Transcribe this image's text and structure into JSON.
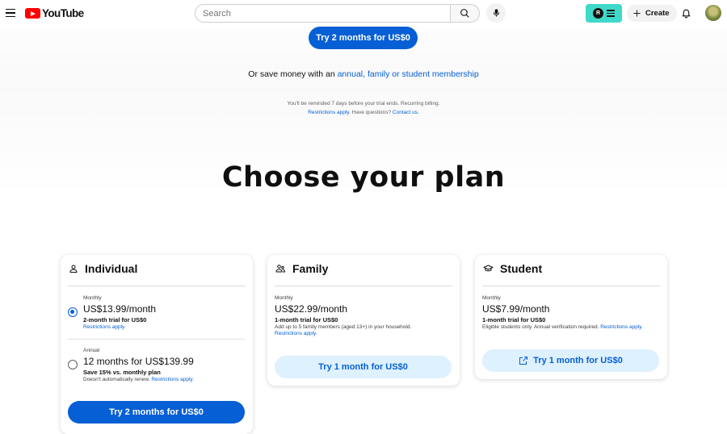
{
  "topbar": {
    "logo_text": "YouTube",
    "search_placeholder": "Search",
    "create_label": "Create",
    "extension_badge": "R"
  },
  "hero": {
    "cta_label": "Try 2 months for US$0",
    "save_prefix": "Or save money with an ",
    "save_link": "annual, family or student membership",
    "reminder": "You'll be reminded 7 days before your trial ends. Recurring billing.",
    "restrictions_link": "Restrictions apply.",
    "questions_text": " Have questions? ",
    "contact_link": "Contact us."
  },
  "headline": "Choose your plan",
  "plans": {
    "individual": {
      "title": "Individual",
      "monthly": {
        "period": "Monthly",
        "price": "US$13.99/month",
        "trial": "2-month trial for US$0",
        "restrictions": "Restrictions apply."
      },
      "annual": {
        "period": "Annual",
        "price": "12 months for US$139.99",
        "trial": "Save 15% vs. monthly plan",
        "note": "Doesn't automatically renew. ",
        "restrictions": "Restrictions apply."
      },
      "cta_label": "Try 2 months for US$0"
    },
    "family": {
      "title": "Family",
      "period": "Monthly",
      "price": "US$22.99/month",
      "trial": "1-month trial for US$0",
      "note": "Add up to 5 family members (aged 13+) in your household.",
      "restrictions": "Restrictions apply.",
      "cta_label": "Try 1 month for US$0"
    },
    "student": {
      "title": "Student",
      "period": "Monthly",
      "price": "US$7.99/month",
      "trial": "1-month trial for US$0",
      "note": "Eligible students only. Annual verification required. ",
      "restrictions": "Restrictions apply.",
      "cta_label": "Try 1 month for US$0"
    }
  },
  "colors": {
    "accent": "#065fd4",
    "tonal": "#def1ff",
    "extension": "#3fd9c9",
    "logo_red": "#ff0000"
  }
}
